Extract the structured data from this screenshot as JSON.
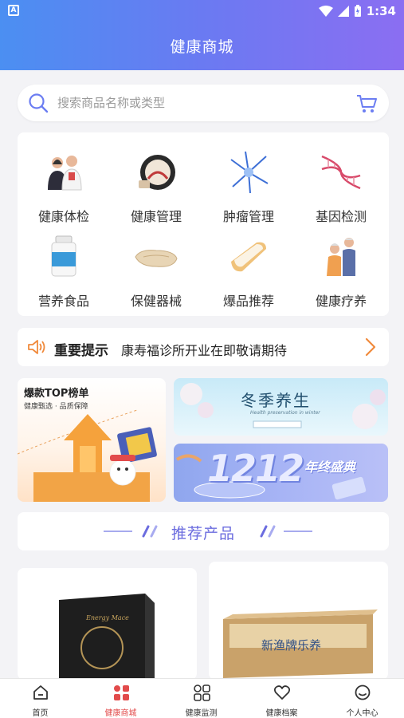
{
  "status_bar": {
    "time": "1:34"
  },
  "header": {
    "title": "健康商城"
  },
  "search": {
    "placeholder": "搜索商品名称或类型"
  },
  "categories": [
    {
      "label": "健康体检",
      "icon": "doctors-icon"
    },
    {
      "label": "健康管理",
      "icon": "scale-icon"
    },
    {
      "label": "肿瘤管理",
      "icon": "neuron-icon"
    },
    {
      "label": "基因检测",
      "icon": "dna-icon"
    },
    {
      "label": "营养食品",
      "icon": "supplement-bottle-icon"
    },
    {
      "label": "保健器械",
      "icon": "pillow-icon"
    },
    {
      "label": "爆品推荐",
      "icon": "mattress-icon"
    },
    {
      "label": "健康疗养",
      "icon": "elderly-couple-icon"
    }
  ],
  "notice": {
    "title": "重要提示",
    "text": "康寿福诊所开业在即敬请期待"
  },
  "banners": {
    "top_list": {
      "title": "爆款TOP榜单",
      "subtitle": "健康甄选 · 品质保障"
    },
    "winter": {
      "title": "冬季养生",
      "subtitle": "Health preservation in winter"
    },
    "sale": {
      "number": "1212",
      "text": "年终盛典"
    }
  },
  "recommend": {
    "title": "推荐产品"
  },
  "products": [
    {
      "name": "Energy Mace"
    },
    {
      "name": "新渔牌乐养"
    }
  ],
  "tabbar": [
    {
      "label": "首页",
      "icon": "home-icon",
      "active": false
    },
    {
      "label": "健康商城",
      "icon": "shop-grid-icon",
      "active": true
    },
    {
      "label": "健康监测",
      "icon": "monitor-grid-icon",
      "active": false
    },
    {
      "label": "健康档案",
      "icon": "heart-icon",
      "active": false
    },
    {
      "label": "个人中心",
      "icon": "profile-icon",
      "active": false
    }
  ],
  "colors": {
    "header_start": "#4b8ff2",
    "header_end": "#8b6ef2",
    "accent": "#6b6cdf",
    "active_tab": "#e24b4b"
  }
}
